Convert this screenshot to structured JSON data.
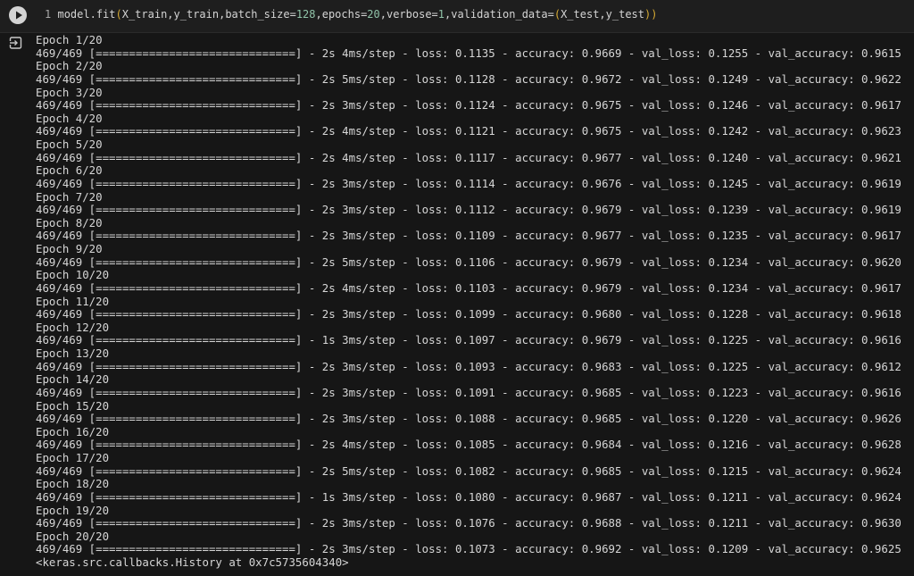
{
  "cell": {
    "line_number": "1",
    "code_pre": "model.fit",
    "paren_open": "(",
    "args1": "X_train,y_train,batch_size=",
    "batch_size": "128",
    "args2": ",epochs=",
    "epochs": "20",
    "args3": ",verbose=",
    "verbose": "1",
    "args4": ",validation_data=",
    "vd_open": "(",
    "vd_args": "X_test,y_test",
    "vd_close": ")",
    "paren_close": ")",
    "run_icon": "play-icon",
    "output_icon": "output-redirect-icon"
  },
  "output": {
    "lines": [
      "Epoch 1/20",
      "469/469 [==============================] - 2s 4ms/step - loss: 0.1135 - accuracy: 0.9669 - val_loss: 0.1255 - val_accuracy: 0.9615",
      "Epoch 2/20",
      "469/469 [==============================] - 2s 5ms/step - loss: 0.1128 - accuracy: 0.9672 - val_loss: 0.1249 - val_accuracy: 0.9622",
      "Epoch 3/20",
      "469/469 [==============================] - 2s 3ms/step - loss: 0.1124 - accuracy: 0.9675 - val_loss: 0.1246 - val_accuracy: 0.9617",
      "Epoch 4/20",
      "469/469 [==============================] - 2s 4ms/step - loss: 0.1121 - accuracy: 0.9675 - val_loss: 0.1242 - val_accuracy: 0.9623",
      "Epoch 5/20",
      "469/469 [==============================] - 2s 4ms/step - loss: 0.1117 - accuracy: 0.9677 - val_loss: 0.1240 - val_accuracy: 0.9621",
      "Epoch 6/20",
      "469/469 [==============================] - 2s 3ms/step - loss: 0.1114 - accuracy: 0.9676 - val_loss: 0.1245 - val_accuracy: 0.9619",
      "Epoch 7/20",
      "469/469 [==============================] - 2s 3ms/step - loss: 0.1112 - accuracy: 0.9679 - val_loss: 0.1239 - val_accuracy: 0.9619",
      "Epoch 8/20",
      "469/469 [==============================] - 2s 3ms/step - loss: 0.1109 - accuracy: 0.9677 - val_loss: 0.1235 - val_accuracy: 0.9617",
      "Epoch 9/20",
      "469/469 [==============================] - 2s 5ms/step - loss: 0.1106 - accuracy: 0.9679 - val_loss: 0.1234 - val_accuracy: 0.9620",
      "Epoch 10/20",
      "469/469 [==============================] - 2s 4ms/step - loss: 0.1103 - accuracy: 0.9679 - val_loss: 0.1234 - val_accuracy: 0.9617",
      "Epoch 11/20",
      "469/469 [==============================] - 2s 3ms/step - loss: 0.1099 - accuracy: 0.9680 - val_loss: 0.1228 - val_accuracy: 0.9618",
      "Epoch 12/20",
      "469/469 [==============================] - 1s 3ms/step - loss: 0.1097 - accuracy: 0.9679 - val_loss: 0.1225 - val_accuracy: 0.9616",
      "Epoch 13/20",
      "469/469 [==============================] - 2s 3ms/step - loss: 0.1093 - accuracy: 0.9683 - val_loss: 0.1225 - val_accuracy: 0.9612",
      "Epoch 14/20",
      "469/469 [==============================] - 2s 3ms/step - loss: 0.1091 - accuracy: 0.9685 - val_loss: 0.1223 - val_accuracy: 0.9616",
      "Epoch 15/20",
      "469/469 [==============================] - 2s 3ms/step - loss: 0.1088 - accuracy: 0.9685 - val_loss: 0.1220 - val_accuracy: 0.9626",
      "Epoch 16/20",
      "469/469 [==============================] - 2s 4ms/step - loss: 0.1085 - accuracy: 0.9684 - val_loss: 0.1216 - val_accuracy: 0.9628",
      "Epoch 17/20",
      "469/469 [==============================] - 2s 5ms/step - loss: 0.1082 - accuracy: 0.9685 - val_loss: 0.1215 - val_accuracy: 0.9624",
      "Epoch 18/20",
      "469/469 [==============================] - 1s 3ms/step - loss: 0.1080 - accuracy: 0.9687 - val_loss: 0.1211 - val_accuracy: 0.9624",
      "Epoch 19/20",
      "469/469 [==============================] - 2s 3ms/step - loss: 0.1076 - accuracy: 0.9688 - val_loss: 0.1211 - val_accuracy: 0.9630",
      "Epoch 20/20",
      "469/469 [==============================] - 2s 3ms/step - loss: 0.1073 - accuracy: 0.9692 - val_loss: 0.1209 - val_accuracy: 0.9625",
      "<keras.src.callbacks.History at 0x7c5735604340>"
    ]
  },
  "colors": {
    "background": "#161616",
    "cell_background": "#1e1e1e",
    "text": "#d6d6d6",
    "paren": "#d4a832",
    "number": "#90c3a8"
  }
}
